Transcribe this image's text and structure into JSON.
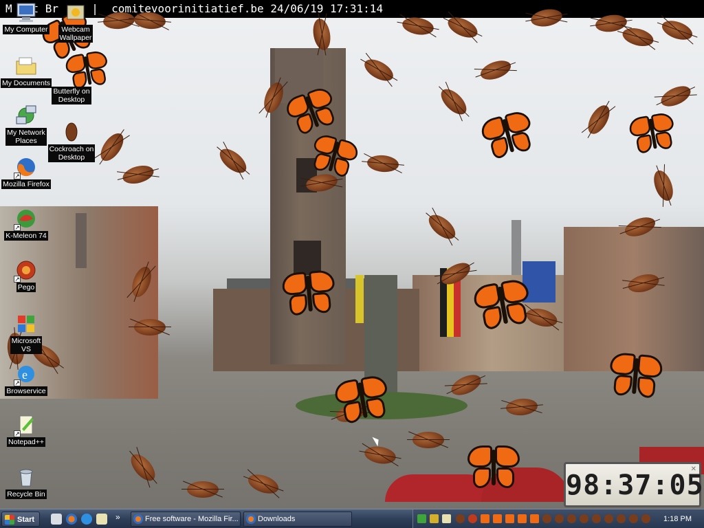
{
  "wallpaper": {
    "caption": "M   t Br     |  comitevoorinitiatief.be 24/06/19 17:31:14"
  },
  "desktop_icons": [
    {
      "name": "my-computer",
      "label": "My Computer",
      "icon": "computer-icon"
    },
    {
      "name": "webcam-wallpaper",
      "label": "Webcam\nWallpaper",
      "icon": "webcam-icon"
    },
    {
      "name": "my-documents",
      "label": "My Documents",
      "icon": "folder-icon"
    },
    {
      "name": "butterfly-on-desktop",
      "label": "Butterfly on\nDesktop",
      "icon": "butterfly-icon"
    },
    {
      "name": "my-network-places",
      "label": "My Network\nPlaces",
      "icon": "network-icon"
    },
    {
      "name": "cockroach-on-desktop",
      "label": "Cockroach on\nDesktop",
      "icon": "cockroach-icon"
    },
    {
      "name": "mozilla-firefox",
      "label": "Mozilla Firefox",
      "icon": "firefox-icon"
    },
    {
      "name": "k-meleon",
      "label": "K-Meleon 74",
      "icon": "kmeleon-icon"
    },
    {
      "name": "pego",
      "label": "Pego",
      "icon": "pego-icon"
    },
    {
      "name": "microsoft-vs",
      "label": "Microsoft\nVS",
      "icon": "microsoft-icon"
    },
    {
      "name": "browservice",
      "label": "Browservice",
      "icon": "ie-icon"
    },
    {
      "name": "notepad-plus-plus",
      "label": "Notepad++",
      "icon": "notepad-icon"
    },
    {
      "name": "recycle-bin",
      "label": "Recycle Bin",
      "icon": "recycle-bin-icon"
    }
  ],
  "clock_widget": {
    "time": "98:37:05"
  },
  "taskbar": {
    "start_label": "Start",
    "quick_launch_more": "»",
    "tasks": [
      {
        "label": "Free software - Mozilla Fir...",
        "icon": "firefox-icon"
      },
      {
        "label": "Downloads",
        "icon": "firefox-icon"
      }
    ],
    "clock": "1:18 PM"
  },
  "colors": {
    "taskbar": "#2f3f59",
    "butterfly": "#ef6a12",
    "cockroach": "#7a3d1c"
  }
}
